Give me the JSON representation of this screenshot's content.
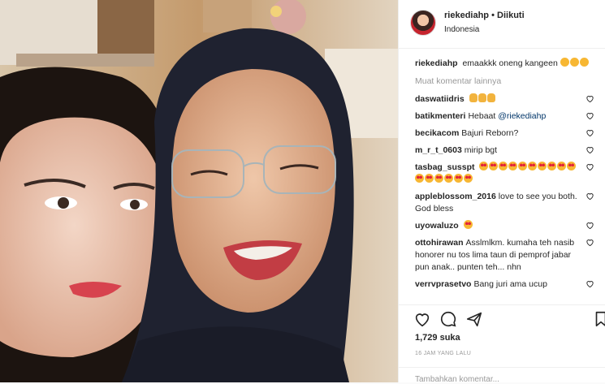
{
  "post": {
    "username": "riekediahp",
    "follow_sep": "•",
    "follow_status": "Diikuti",
    "location": "Indonesia"
  },
  "caption": {
    "username": "riekediahp",
    "text": "emaakkk oneng kangeen"
  },
  "load_more": "Muat komentar lainnya",
  "comments": [
    {
      "user": "daswatiidris",
      "text": ""
    },
    {
      "user": "batikmenteri",
      "text": "Hebaat ",
      "mention": "@riekediahp"
    },
    {
      "user": "becikacom",
      "text": "Bajuri Reborn?"
    },
    {
      "user": "m_r_t_0603",
      "text": "mirip bgt"
    },
    {
      "user": "tasbag_susspt",
      "text": ""
    },
    {
      "user": "appleblossom_2016",
      "text": "love to see you both. God bless"
    },
    {
      "user": "uyowaluzo",
      "text": ""
    },
    {
      "user": "ottohirawan",
      "text": "Asslmlkm. kumaha teh nasib honorer nu tos lima taun di pemprof jabar pun anak.. punten teh... nhn"
    },
    {
      "user": "verrvprasetvo",
      "text": "Bang juri ama ucup"
    }
  ],
  "icons": {
    "like": "heart-icon",
    "comment": "comment-icon",
    "share": "share-icon",
    "save": "bookmark-icon",
    "comment_like": "heart-icon"
  },
  "likes": "1,729 suka",
  "date": "16 JAM YANG LALU",
  "add_comment_placeholder": "Tambahkan komentar..."
}
